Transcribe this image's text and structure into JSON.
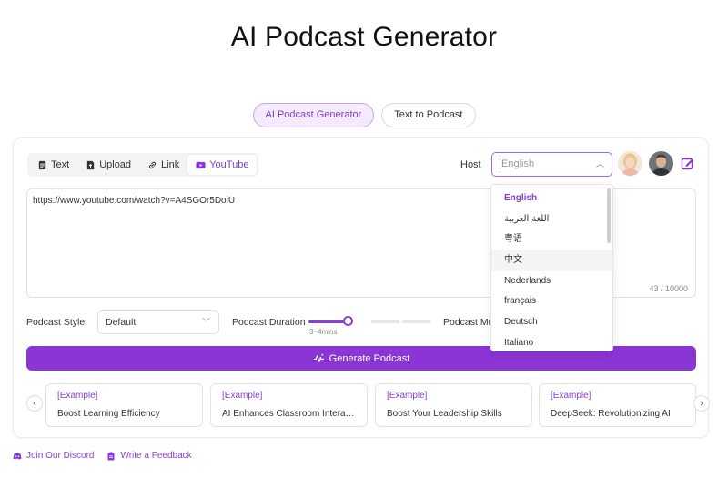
{
  "page": {
    "title": "AI Podcast Generator"
  },
  "mode_tabs": [
    {
      "label": "AI Podcast Generator",
      "active": true
    },
    {
      "label": "Text to Podcast",
      "active": false
    }
  ],
  "source_tabs": [
    {
      "label": "Text",
      "icon": "document-icon",
      "active": false
    },
    {
      "label": "Upload",
      "icon": "upload-icon",
      "active": false
    },
    {
      "label": "Link",
      "icon": "link-icon",
      "active": false
    },
    {
      "label": "YouTube",
      "icon": "youtube-icon",
      "active": true
    }
  ],
  "host": {
    "label": "Host",
    "placeholder": "English",
    "options": [
      "English",
      "اللغة العربية",
      "粤语",
      "中文",
      "Nederlands",
      "français",
      "Deutsch",
      "Italiano"
    ],
    "selected": "English",
    "hovered": "中文"
  },
  "input": {
    "value": "https://www.youtube.com/watch?v=A4SGOr5DoiU",
    "char_count": "43 / 10000"
  },
  "controls": {
    "style_label": "Podcast Style",
    "style_value": "Default",
    "duration_label": "Podcast Duration",
    "duration_value": "3~4mins",
    "duration_level": 0.33,
    "music_label": "Podcast Music"
  },
  "generate_button": {
    "label": "Generate Podcast"
  },
  "examples": [
    {
      "tag": "[Example]",
      "title": "Boost Learning Efficiency"
    },
    {
      "tag": "[Example]",
      "title": "AI Enhances Classroom Interaction"
    },
    {
      "tag": "[Example]",
      "title": "Boost Your Leadership Skills"
    },
    {
      "tag": "[Example]",
      "title": "DeepSeek: Revolutionizing AI"
    }
  ],
  "footer": {
    "discord": "Join Our Discord",
    "feedback": "Write a Feedback"
  },
  "colors": {
    "accent": "#8b35d6",
    "accent_light": "#f3eafc"
  }
}
